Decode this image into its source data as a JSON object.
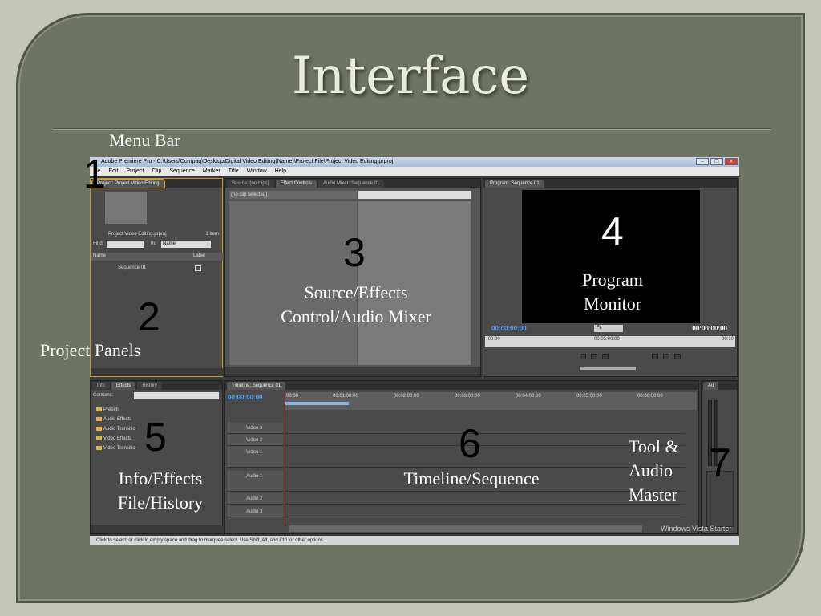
{
  "slide": {
    "title": "Interface",
    "callouts": {
      "menu_bar": "Menu Bar",
      "project_panels": "Project Panels",
      "source_effects_line1": "Source/Effects",
      "source_effects_line2": "Control/Audio Mixer",
      "program_monitor_line1": "Program",
      "program_monitor_line2": "Monitor",
      "info_effects_line1": "Info/Effects",
      "info_effects_line2": "File/History",
      "timeline_sequence": "Timeline/Sequence",
      "tool_audio_line1": "Tool &",
      "tool_audio_line2": "Audio",
      "tool_audio_line3": "Master"
    },
    "numbers": [
      "1",
      "2",
      "3",
      "4",
      "5",
      "6",
      "7"
    ]
  },
  "app": {
    "window_title": "Adobe Premiere Pro - C:\\Users\\Compaq\\Desktop\\Digital Video Editing(Name)\\Project File\\Project Video Editing.prproj",
    "menu": [
      "le",
      "Edit",
      "Project",
      "Clip",
      "Sequence",
      "Marker",
      "Title",
      "Window",
      "Help"
    ],
    "project_panel": {
      "tab": "Project: Project Video Editing",
      "file_name": "Project Video Editing.prproj",
      "item_count": "1 Item",
      "find_label": "Find:",
      "in_label": "In:",
      "in_value": "Name",
      "col_name": "Name",
      "col_label": "Label",
      "sequence": "Sequence 01"
    },
    "source_panel": {
      "tabs": [
        "Source: (no clips)",
        "Effect Controls",
        "Audio Mixer: Sequence 01"
      ],
      "clip_select": "(no clip selected)"
    },
    "program_panel": {
      "tab": "Program: Sequence 01",
      "timecode_left": "00:00:00:00",
      "fit": "Fit",
      "timecode_right": "00:00:00:00",
      "ruler_start": ":00:00",
      "ruler_mid": "00:05:00:00",
      "ruler_end": "00:10"
    },
    "info_panel": {
      "tabs": [
        "Info",
        "Effects",
        "History"
      ],
      "contains_label": "Contains:",
      "items": [
        "Presets",
        "Audio Effects",
        "Audio Transitio",
        "Video Effects",
        "Video Transitio"
      ]
    },
    "timeline_panel": {
      "tab": "Timeline: Sequence 01",
      "timecode": "00:00:00:00",
      "ruler": [
        "00:00",
        "00:01:00:00",
        "00:02:00:00",
        "00:03:00:00",
        "00:04:00:00",
        "00:05:00:00",
        "00:06:00:00"
      ],
      "tracks": [
        "Video 3",
        "Video 2",
        "Video 1",
        "Audio 1",
        "Audio 2",
        "Audio 3"
      ]
    },
    "audio_master": {
      "label": "Au"
    },
    "status": "Click to select, or click in empty space and drag to marquee select. Use Shift, Alt, and Ctrl for other options.",
    "os_logo": "Windows Vista Starter"
  }
}
